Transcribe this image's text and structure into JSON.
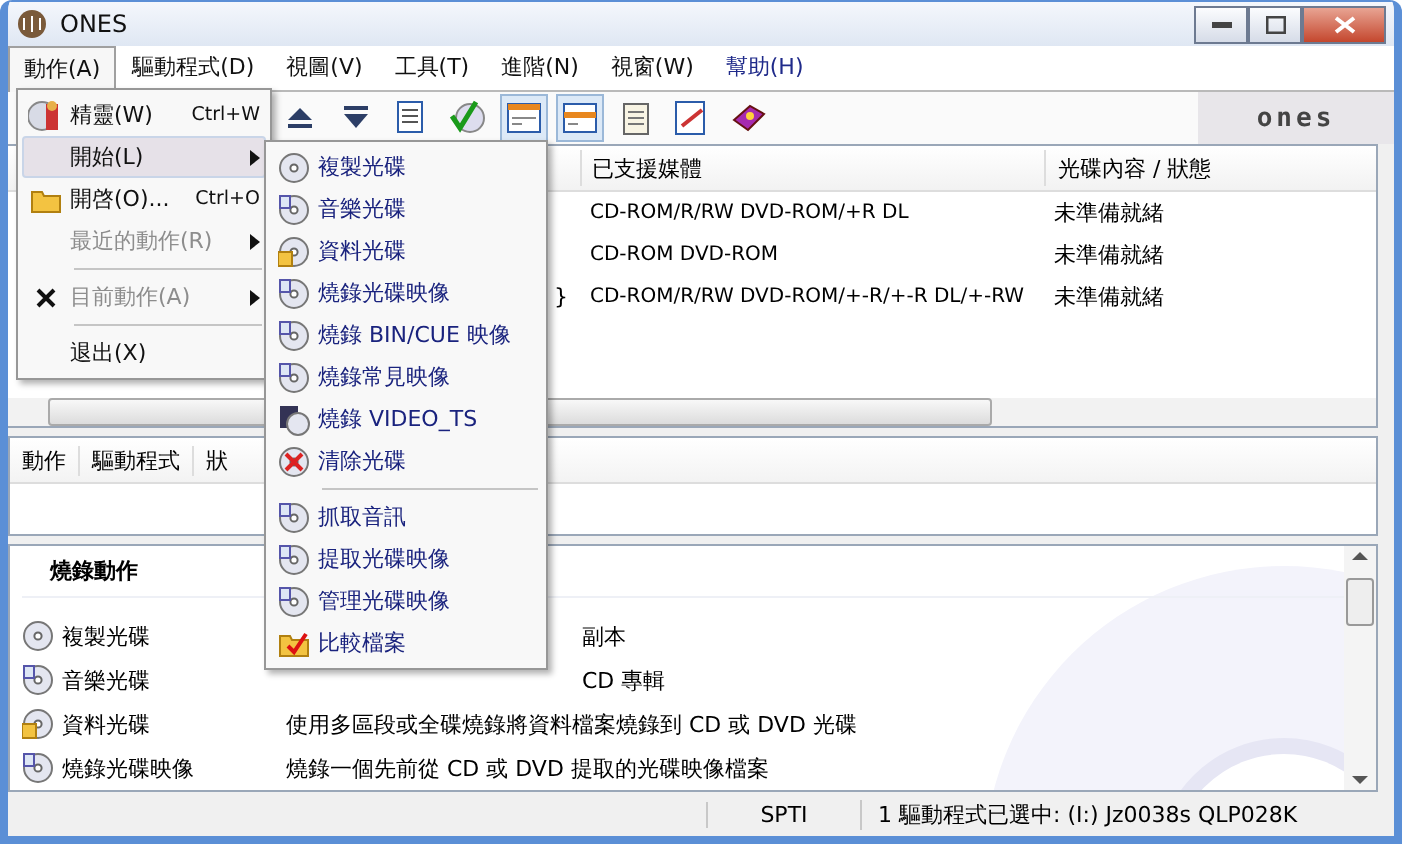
{
  "window": {
    "title": "ONES"
  },
  "menubar": [
    {
      "label": "動作(A)",
      "selected": true
    },
    {
      "label": "驅動程式(D)",
      "selected": false
    },
    {
      "label": "視圖(V)",
      "selected": false
    },
    {
      "label": "工具(T)",
      "selected": false
    },
    {
      "label": "進階(N)",
      "selected": false
    },
    {
      "label": "視窗(W)",
      "selected": false
    },
    {
      "label": "幫助(H)",
      "selected": false
    }
  ],
  "toolbar": {
    "pressed": [
      false,
      false,
      false,
      false,
      true,
      true,
      false,
      false,
      false
    ],
    "logo": "ones"
  },
  "drive_table": {
    "columns": [
      "已支援媒體",
      "光碟內容 / 狀態"
    ],
    "rows": [
      {
        "fragment": "",
        "media": "CD-ROM/R/RW DVD-ROM/+R DL",
        "status": "未準備就緒"
      },
      {
        "fragment": "",
        "media": "CD-ROM DVD-ROM",
        "status": "未準備就緒"
      },
      {
        "fragment": "}",
        "media": "CD-ROM/R/RW DVD-ROM/+-R/+-R DL/+-RW",
        "status": "未準備就緒"
      }
    ]
  },
  "action_tabs": [
    "動作",
    "驅動程式",
    "狀"
  ],
  "burn_actions": {
    "title": "燒錄動作",
    "items": [
      {
        "name": "複製光碟",
        "description": "副本"
      },
      {
        "name": "音樂光碟",
        "description": "CD 專輯"
      },
      {
        "name": "資料光碟",
        "description": "使用多區段或全碟燒錄將資料檔案燒錄到 CD 或 DVD 光碟"
      },
      {
        "name": "燒錄光碟映像",
        "description": "燒錄一個先前從 CD 或 DVD 提取的光碟映像檔案"
      }
    ]
  },
  "status_bar": [
    "SPTI",
    "1 驅動程式已選中: (I:) Jz0038s QLP028K"
  ],
  "action_menu": [
    {
      "kind": "item",
      "label": "精靈(W)",
      "shortcut": "Ctrl+W",
      "selected": false,
      "disabled": false,
      "submenu": false
    },
    {
      "kind": "item",
      "label": "開始(L)",
      "selected": true,
      "disabled": false,
      "submenu": true
    },
    {
      "kind": "item",
      "label": "開啓(O)...",
      "shortcut": "Ctrl+O",
      "selected": false,
      "disabled": false,
      "submenu": false
    },
    {
      "kind": "item",
      "label": "最近的動作(R)",
      "selected": false,
      "disabled": true,
      "submenu": true
    },
    {
      "kind": "separator"
    },
    {
      "kind": "item",
      "label": "目前動作(A)",
      "selected": false,
      "disabled": true,
      "submenu": true
    },
    {
      "kind": "separator"
    },
    {
      "kind": "item",
      "label": "退出(X)",
      "selected": false,
      "disabled": false,
      "submenu": false
    }
  ],
  "start_submenu": [
    {
      "kind": "item",
      "label": "複製光碟"
    },
    {
      "kind": "item",
      "label": "音樂光碟"
    },
    {
      "kind": "item",
      "label": "資料光碟"
    },
    {
      "kind": "item",
      "label": "燒錄光碟映像"
    },
    {
      "kind": "item",
      "label": "燒錄 BIN/CUE 映像"
    },
    {
      "kind": "item",
      "label": "燒錄常見映像"
    },
    {
      "kind": "item",
      "label": "燒錄 VIDEO_TS"
    },
    {
      "kind": "item",
      "label": "清除光碟"
    },
    {
      "kind": "separator"
    },
    {
      "kind": "item",
      "label": "抓取音訊"
    },
    {
      "kind": "item",
      "label": "提取光碟映像"
    },
    {
      "kind": "item",
      "label": "管理光碟映像"
    },
    {
      "kind": "item",
      "label": "比較檔案"
    }
  ]
}
